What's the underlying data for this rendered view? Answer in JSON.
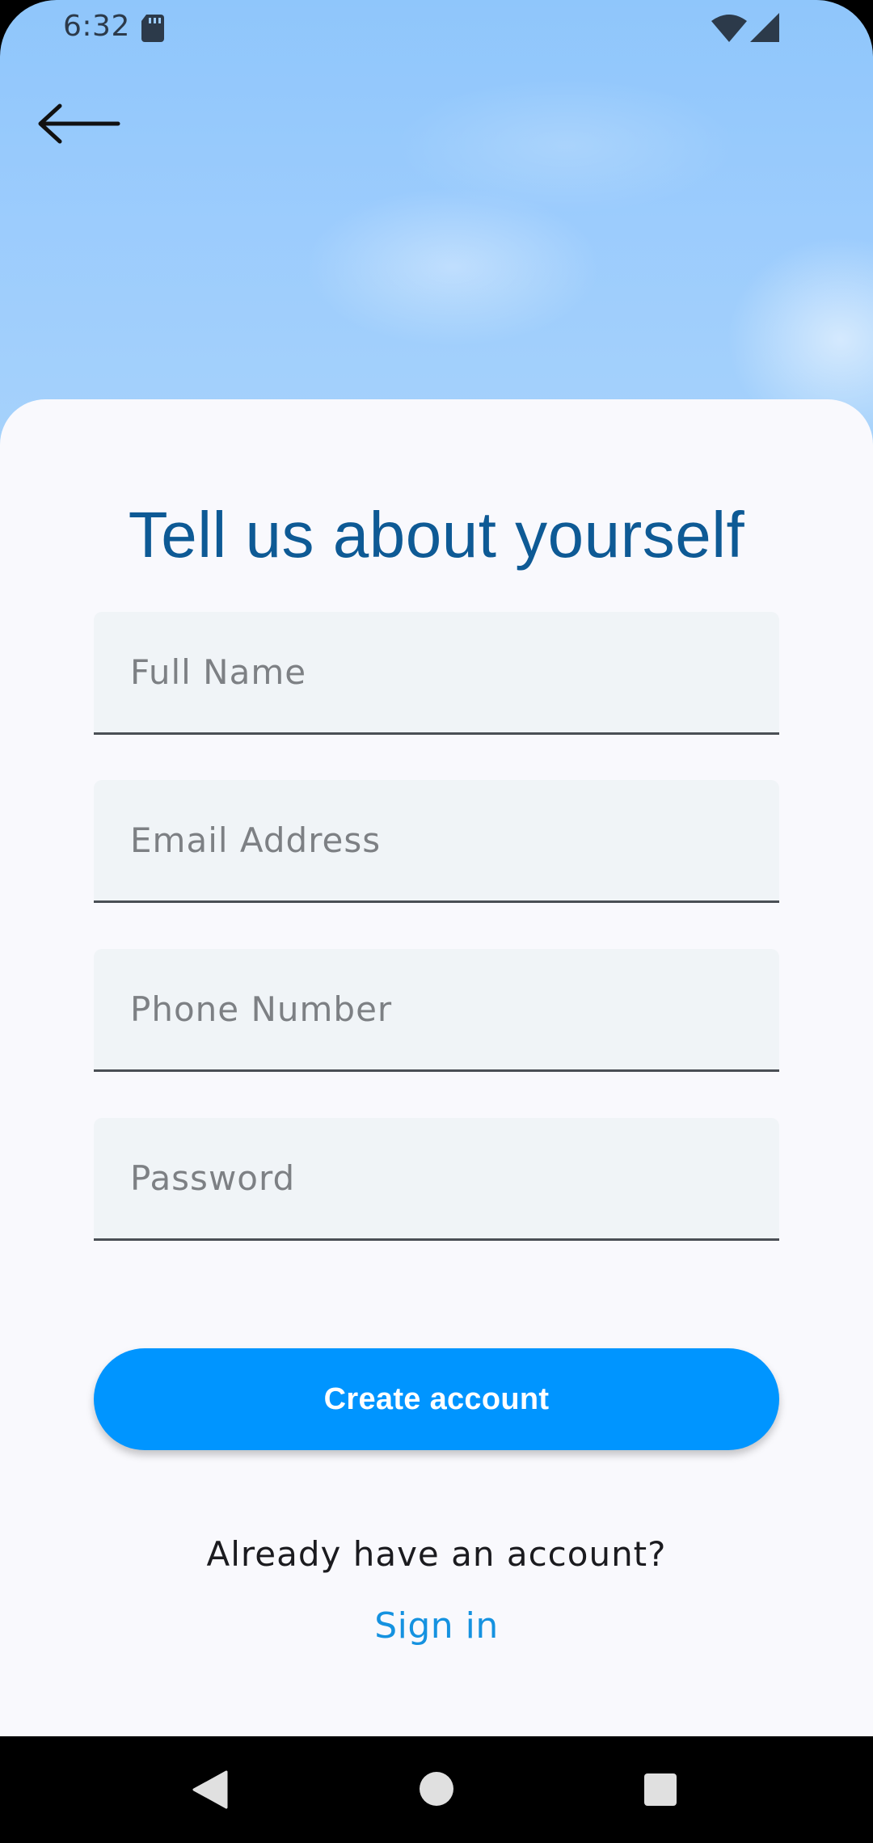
{
  "status_bar": {
    "time": "6:32",
    "icons": [
      "sd-card-icon",
      "wifi-icon",
      "cellular-signal-icon"
    ]
  },
  "header": {
    "back_icon": "arrow-left-icon"
  },
  "form": {
    "title": "Tell us about yourself",
    "fields": {
      "full_name": {
        "placeholder": "Full Name",
        "value": ""
      },
      "email": {
        "placeholder": "Email Address",
        "value": ""
      },
      "phone": {
        "placeholder": "Phone Number",
        "value": ""
      },
      "password": {
        "placeholder": "Password",
        "value": ""
      }
    },
    "create_button_label": "Create account",
    "already_text": "Already have an account?",
    "sign_in_label": "Sign in"
  },
  "nav_bar": {
    "icons": [
      "back-triangle-icon",
      "home-circle-icon",
      "recents-square-icon"
    ]
  },
  "colors": {
    "title": "#0e5a95",
    "primary_button": "#0095ff",
    "link": "#1592e0",
    "field_background": "#f0f4f7",
    "card_background": "#f9f9fd",
    "sky": "#9cccfd"
  }
}
